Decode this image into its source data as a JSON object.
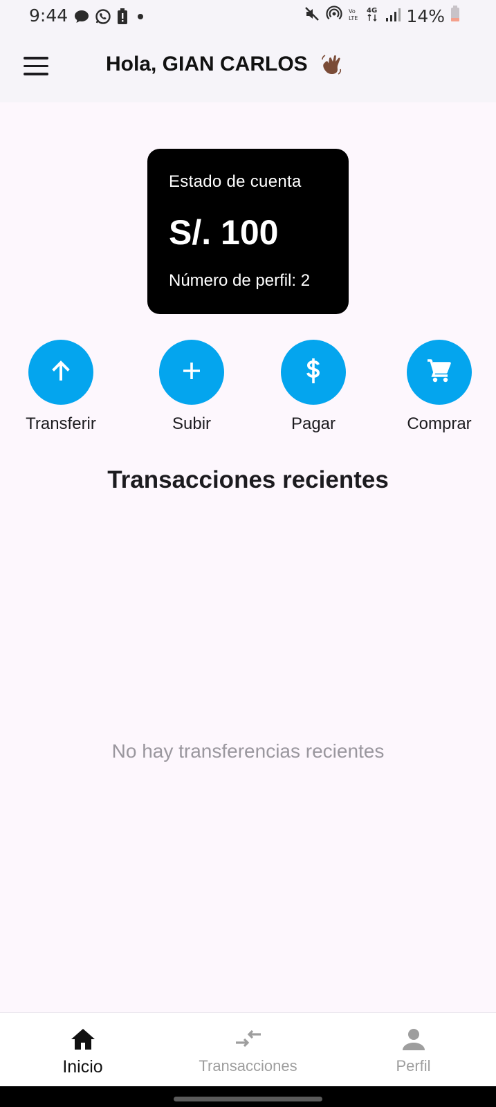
{
  "status_bar": {
    "time": "9:44",
    "left_icons": [
      "chat-bubble-icon",
      "whatsapp-icon",
      "alert-battery-icon",
      "dot-icon"
    ],
    "right_icons": [
      "mute-icon",
      "hotspot-icon",
      "volte-icon",
      "4g-icon",
      "signal-icon"
    ],
    "battery": "14%"
  },
  "app_bar": {
    "greeting": "Hola, GIAN CARLOS"
  },
  "account_card": {
    "title": "Estado de cuenta",
    "balance": "S/. 100",
    "profile": "Número de perfil: 2"
  },
  "actions": [
    {
      "label": "Transferir",
      "icon": "arrow-up-icon"
    },
    {
      "label": "Subir",
      "icon": "plus-icon"
    },
    {
      "label": "Pagar",
      "icon": "dollar-icon"
    },
    {
      "label": "Comprar",
      "icon": "cart-icon"
    }
  ],
  "recent": {
    "title": "Transacciones recientes",
    "empty": "No hay transferencias recientes"
  },
  "bottom_nav": {
    "items": [
      {
        "label": "Inicio",
        "icon": "home-icon",
        "active": true
      },
      {
        "label": "Transacciones",
        "icon": "swap-arrows-icon",
        "active": false
      },
      {
        "label": "Perfil",
        "icon": "person-icon",
        "active": false
      }
    ]
  },
  "colors": {
    "accent": "#04a5ee",
    "background": "#fdf7fd",
    "appbar": "#f6f4f9",
    "card": "#000000"
  }
}
